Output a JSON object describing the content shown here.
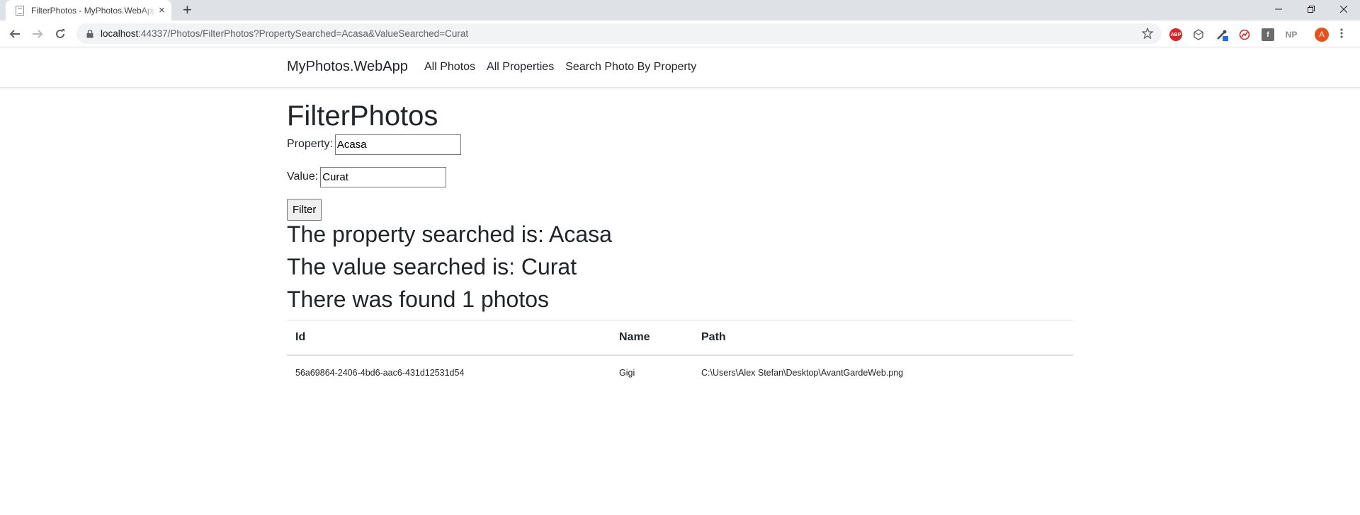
{
  "browser": {
    "tab_title": "FilterPhotos - MyPhotos.WebApp",
    "tab_close": "×",
    "new_tab": "+",
    "url_host": "localhost",
    "url_rest": ":44337/Photos/FilterPhotos?PropertySearched=Acasa&ValueSearched=Curat",
    "ext_abp_label": "ABP",
    "ext_fb_label": "f",
    "ext_np_label": "NP",
    "avatar_letter": "A",
    "avatar_color": "#e8501c"
  },
  "nav": {
    "brand": "MyPhotos.WebApp",
    "links": [
      "All Photos",
      "All Properties",
      "Search Photo By Property"
    ]
  },
  "page": {
    "title": "FilterPhotos",
    "property_label": "Property:",
    "property_value": "Acasa",
    "value_label": "Value:",
    "value_value": "Curat",
    "filter_button": "Filter",
    "property_result": "The property searched is: Acasa",
    "value_result": "The value searched is: Curat",
    "found_result": "There was found 1 photos"
  },
  "table": {
    "headers": [
      "Id",
      "Name",
      "Path"
    ],
    "rows": [
      [
        "56a69864-2406-4bd6-aac6-431d12531d54",
        "Gigi",
        "C:\\Users\\Alex Stefan\\Desktop\\AvantGardeWeb.png"
      ]
    ]
  }
}
